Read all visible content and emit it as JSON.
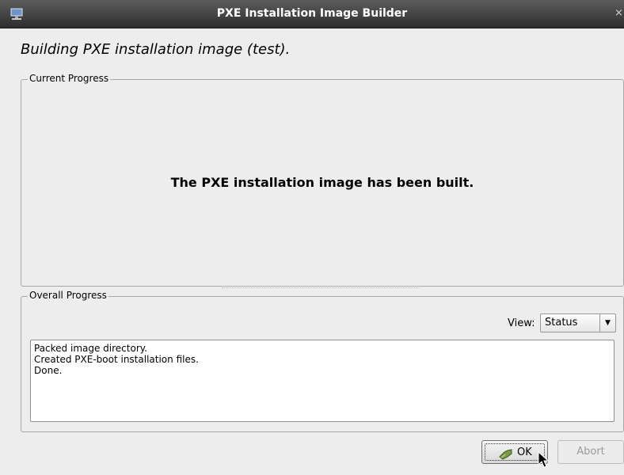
{
  "window": {
    "title": "PXE Installation Image Builder",
    "close_glyph": "×"
  },
  "heading": "Building PXE installation image (test).",
  "current_progress": {
    "legend": "Current Progress",
    "message": "The PXE installation image has been built."
  },
  "overall_progress": {
    "legend": "Overall Progress",
    "view_label": "View:",
    "view_value": "Status",
    "log_lines": [
      "Packed image directory.",
      "Created PXE-boot installation files.",
      "Done."
    ]
  },
  "buttons": {
    "ok": "OK",
    "abort": "Abort"
  },
  "icons": {
    "app": "monitor-network-icon",
    "ok": "approve-icon",
    "dropdown": "chevron-down-icon",
    "cursor": "mouse-pointer-icon"
  },
  "colors": {
    "titlebar": "#3d3d3d",
    "window_bg": "#ededed",
    "log_bg": "#ffffff",
    "disabled_text": "#9a9a9a"
  }
}
